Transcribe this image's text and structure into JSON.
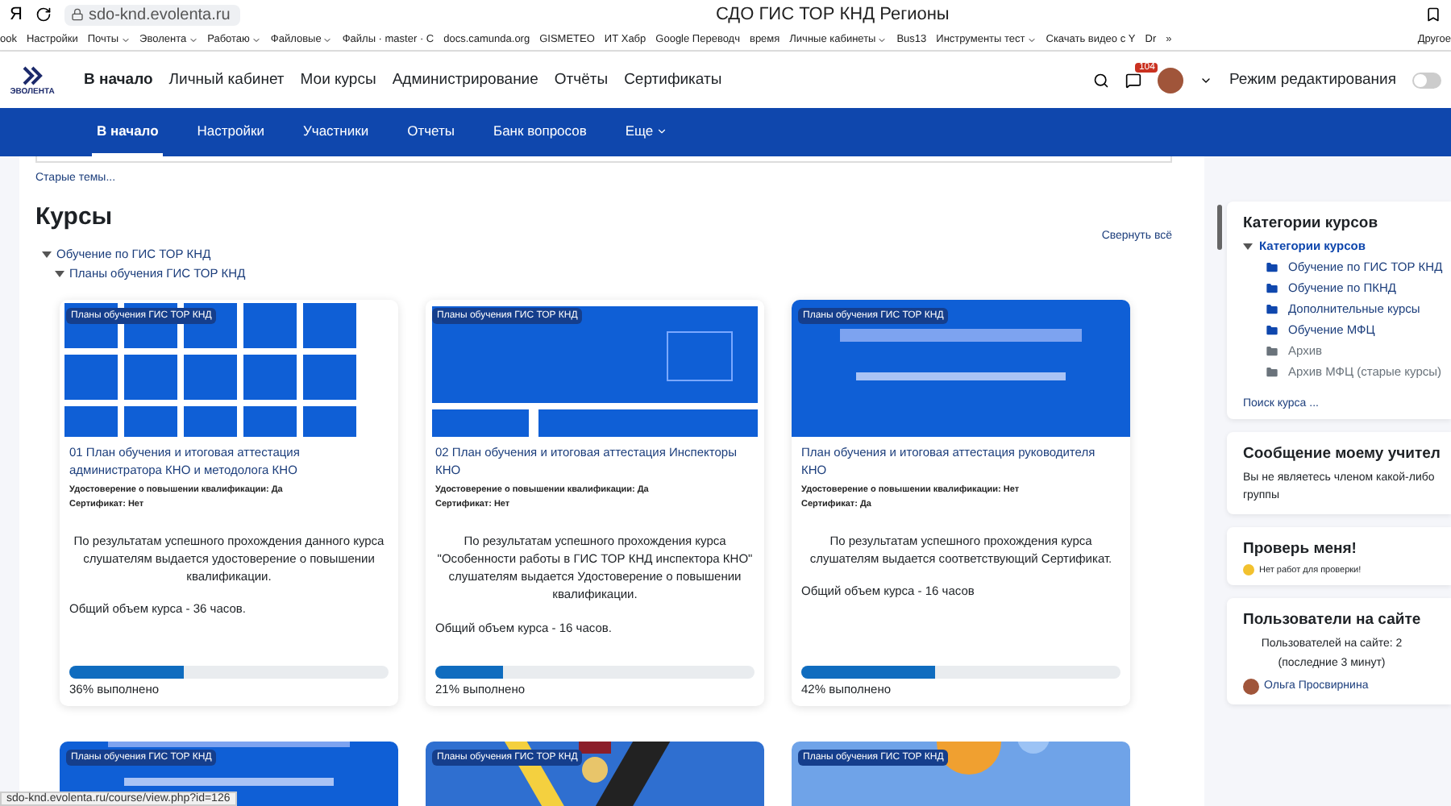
{
  "browser": {
    "title": "СДО ГИС ТОР КНД Регионы",
    "url": "sdo-knd.evolenta.ru",
    "yandex": "Я",
    "bookmarks": [
      {
        "label": "ook",
        "menu": false
      },
      {
        "label": "Настройки",
        "menu": false
      },
      {
        "label": "Почты",
        "menu": true
      },
      {
        "label": "Эволента",
        "menu": true
      },
      {
        "label": "Работаю",
        "menu": true
      },
      {
        "label": "Файловые",
        "menu": true
      },
      {
        "label": "Файлы · master · С",
        "menu": false
      },
      {
        "label": "docs.camunda.org",
        "menu": false
      },
      {
        "label": "GISMETEO",
        "menu": false
      },
      {
        "label": "ИТ Хабр",
        "menu": false
      },
      {
        "label": "Google Переводч",
        "menu": false
      },
      {
        "label": "время",
        "menu": false
      },
      {
        "label": "Личные кабинеты",
        "menu": true
      },
      {
        "label": "Bus13",
        "menu": false
      },
      {
        "label": "Инструменты тест",
        "menu": true
      },
      {
        "label": "Скачать видео с Y",
        "menu": false
      },
      {
        "label": "Dr",
        "menu": false
      }
    ],
    "more": "»",
    "other": "Другое"
  },
  "header": {
    "logo": "ЭВОЛЕНТА",
    "nav": [
      {
        "label": "В начало",
        "selected": true
      },
      {
        "label": "Личный кабинет",
        "selected": false
      },
      {
        "label": "Мои курсы",
        "selected": false
      },
      {
        "label": "Администрирование",
        "selected": false
      },
      {
        "label": "Отчёты",
        "selected": false
      },
      {
        "label": "Сертификаты",
        "selected": false
      }
    ],
    "notifications": "104",
    "edit_mode": {
      "label": "Режим редактирования",
      "on": false
    }
  },
  "tabs": [
    {
      "label": "В начало",
      "selected": true
    },
    {
      "label": "Настройки",
      "selected": false
    },
    {
      "label": "Участники",
      "selected": false
    },
    {
      "label": "Отчеты",
      "selected": false
    },
    {
      "label": "Банк вопросов",
      "selected": false
    },
    {
      "label": "Еще",
      "selected": false
    }
  ],
  "main": {
    "old_topics": "Старые темы...",
    "heading": "Курсы",
    "collapse_all": "Свернуть всё",
    "tree": [
      {
        "label": "Обучение по ГИС ТОР КНД",
        "expanded": true,
        "children": [
          {
            "label": "Планы обучения ГИС ТОР КНД",
            "expanded": true
          }
        ]
      }
    ],
    "courses": [
      {
        "badge": "Планы обучения ГИС ТОР КНД",
        "kind": "tiles",
        "title": "01 План обучения и итоговая аттестация администратора КНО и методолога КНО",
        "details": [
          "Удостоверение о повышении квалификации: Да",
          "Сертификат: Нет"
        ],
        "description": "По результатам успешного прохождения данного курса слушателям выдается удостоверение о повышении квалификации.",
        "volume": "Общий объем курса - 36 часов.",
        "level": 0.36,
        "progress": "36% выполнено"
      },
      {
        "badge": "Планы обучения ГИС ТОР КНД",
        "kind": "screen",
        "title": "02 План обучения и итоговая аттестация Инспекторы КНО",
        "details": [
          "Удостоверение о повышении квалификации: Да",
          "Сертификат: Нет"
        ],
        "description": "По результатам успешного прохождения курса \"Особенности работы в ГИС ТОР КНД инспектора КНО\" слушателям выдается Удостоверение о повышении квалификации.",
        "volume": "Общий объем курса - 16 часов.",
        "level": 0.21,
        "progress": "21% выполнено"
      },
      {
        "badge": "Планы обучения ГИС ТОР КНД",
        "kind": "banner",
        "title": "План обучения и итоговая аттестация руководителя КНО",
        "details": [
          "Удостоверение о повышении квалификации: Нет",
          "Сертификат: Да"
        ],
        "description": "По результатам успешного прохождения курса слушателям выдается соответствующий Сертификат.",
        "volume": "Общий объем курса - 16 часов",
        "level": 0.42,
        "progress": "42% выполнено"
      }
    ],
    "next_courses": [
      {
        "badge": "Планы обучения ГИС ТОР КНД",
        "kind": "banner"
      },
      {
        "badge": "Планы обучения ГИС ТОР КНД",
        "kind": "confetti"
      },
      {
        "badge": "Планы обучения ГИС ТОР КНД",
        "kind": "cup"
      }
    ]
  },
  "sidebar": {
    "categories": {
      "title": "Категории курсов",
      "root": "Категории курсов",
      "items": [
        {
          "label": "Обучение по ГИС ТОР КНД",
          "dimmed": false
        },
        {
          "label": "Обучение по ПКНД",
          "dimmed": false
        },
        {
          "label": "Дополнительные курсы",
          "dimmed": false
        },
        {
          "label": "Обучение МФЦ",
          "dimmed": false
        },
        {
          "label": "Архив",
          "dimmed": true
        },
        {
          "label": "Архив МФЦ (старые курсы)",
          "dimmed": true
        }
      ],
      "search": "Поиск курса ..."
    },
    "message": {
      "title": "Сообщение моему учител",
      "text": "Вы не являетесь членом какой-либо группы"
    },
    "check": {
      "title": "Проверь меня!",
      "text": "Нет работ для проверки!"
    },
    "online": {
      "title": "Пользователи на сайте",
      "summary": "Пользователей на сайте: 2 (последние 3 минут)",
      "users": [
        "Ольга Просвирнина"
      ]
    }
  },
  "status_url": "sdo-knd.evolenta.ru/course/view.php?id=126"
}
